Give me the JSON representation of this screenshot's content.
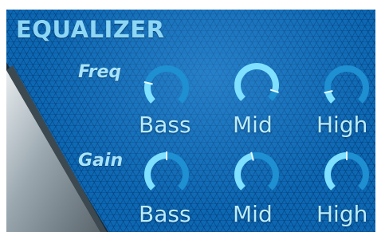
{
  "panel": {
    "title": "EQUALIZER",
    "colors": {
      "background": "#0d68b3",
      "text": "#b9ecfb",
      "track": "#1e8fd0",
      "active": "#7fe0ff"
    }
  },
  "rows": [
    {
      "label": "Freq",
      "knobs": [
        {
          "name": "Bass",
          "level": 0.22
        },
        {
          "name": "Mid",
          "level": 0.9
        },
        {
          "name": "High",
          "level": 0.12
        }
      ]
    },
    {
      "label": "Gain",
      "knobs": [
        {
          "name": "Bass",
          "level": 0.5
        },
        {
          "name": "Mid",
          "level": 0.45
        },
        {
          "name": "High",
          "level": 0.5
        }
      ]
    }
  ]
}
